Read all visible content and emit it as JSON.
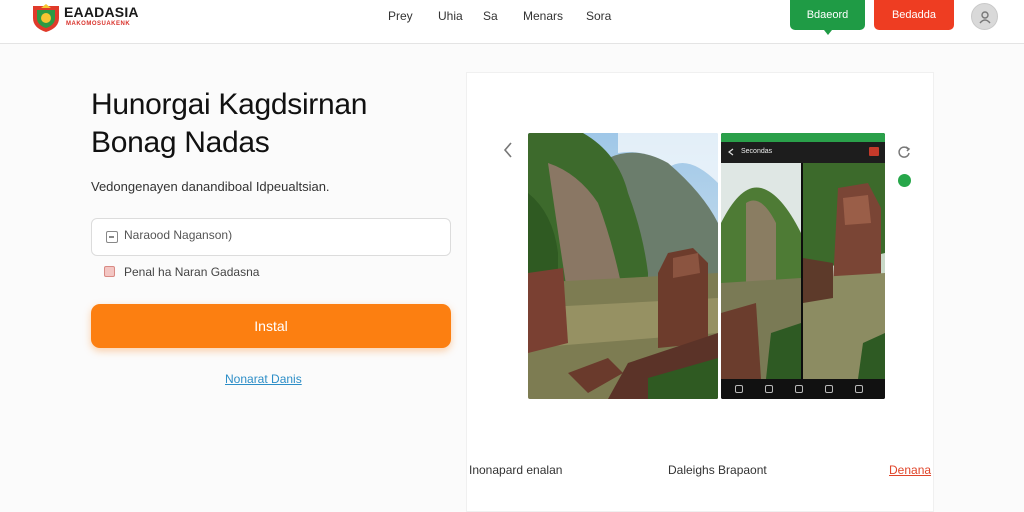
{
  "brand": {
    "name": "EAADASIA",
    "tagline": "MAKOMOSUAKENK"
  },
  "nav": {
    "items": [
      {
        "label": "Prey"
      },
      {
        "label": "Uhia"
      },
      {
        "label": "Sa"
      },
      {
        "label": "Menars"
      },
      {
        "label": "Sora"
      }
    ]
  },
  "header": {
    "green_button": "Bdaeord",
    "red_button": "Bedadda"
  },
  "hero": {
    "title_line1": "Hunorgai Kagdsirnan",
    "title_line2": "Bonag Nadas",
    "subtitle": "Vedongenayen danandiboal Idpeualtsian."
  },
  "form": {
    "input_placeholder": "Naraood Naganson)",
    "checkbox_label": "Penal ha Naran Gadasna",
    "install_label": "Instal",
    "link_label": "Nonarat Danis"
  },
  "gallery": {
    "phone_title": "Secondas"
  },
  "footer": {
    "label_left": "Inonapard enalan",
    "label_mid": "Daleighs Brapaont",
    "link_right": "Denana"
  },
  "colors": {
    "install": "#fc7f11",
    "green_button": "#1f9b45",
    "red_button": "#ee3d22",
    "link": "#2d8ec7",
    "footer_link": "#e0452a"
  },
  "icons": {
    "brand": "logo-shield-icon",
    "avatar": "user-avatar-icon",
    "input": "card-icon",
    "prev": "chevron-left-icon",
    "sync": "refresh-icon",
    "status": "green-dot-icon"
  }
}
